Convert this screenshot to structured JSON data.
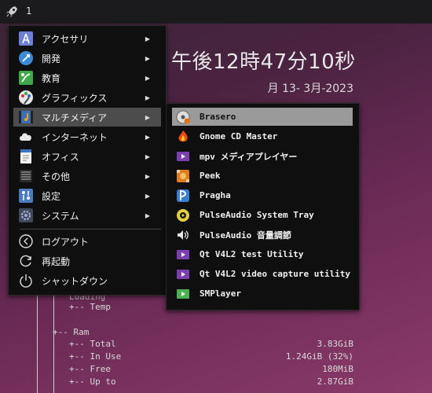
{
  "panel": {
    "workspace": "1",
    "launcher_icon": "rocket-icon"
  },
  "clock": {
    "time": "午後12時47分10秒",
    "date": "月 13- 3月-2023"
  },
  "menu": {
    "items": [
      {
        "label": "アクセサリ",
        "icon": "accessories-icon",
        "has_submenu": true
      },
      {
        "label": "開発",
        "icon": "development-icon",
        "has_submenu": true
      },
      {
        "label": "教育",
        "icon": "education-icon",
        "has_submenu": true
      },
      {
        "label": "グラフィックス",
        "icon": "graphics-icon",
        "has_submenu": true
      },
      {
        "label": "マルチメディア",
        "icon": "multimedia-icon",
        "has_submenu": true,
        "selected": true
      },
      {
        "label": "インターネット",
        "icon": "internet-icon",
        "has_submenu": true
      },
      {
        "label": "オフィス",
        "icon": "office-icon",
        "has_submenu": true
      },
      {
        "label": "その他",
        "icon": "other-icon",
        "has_submenu": true
      },
      {
        "label": "設定",
        "icon": "settings-icon",
        "has_submenu": true
      },
      {
        "label": "システム",
        "icon": "system-icon",
        "has_submenu": true
      }
    ],
    "session": [
      {
        "label": "ログアウト",
        "icon": "logout-icon"
      },
      {
        "label": "再起動",
        "icon": "reboot-icon"
      },
      {
        "label": "シャットダウン",
        "icon": "shutdown-icon"
      }
    ]
  },
  "submenu": {
    "items": [
      {
        "label": "Brasero",
        "icon": "brasero-icon",
        "selected": true
      },
      {
        "label": "Gnome CD Master",
        "icon": "gnome-cd-master-icon"
      },
      {
        "label": "mpv メディアプレイヤー",
        "icon": "mpv-icon"
      },
      {
        "label": "Peek",
        "icon": "peek-icon"
      },
      {
        "label": "Pragha",
        "icon": "pragha-icon"
      },
      {
        "label": "PulseAudio System Tray",
        "icon": "pulseaudio-tray-icon"
      },
      {
        "label": "PulseAudio 音量調節",
        "icon": "volume-icon"
      },
      {
        "label": "Qt V4L2 test Utility",
        "icon": "qv4l2-icon"
      },
      {
        "label": "Qt V4L2 video capture utility",
        "icon": "qvidcap-icon"
      },
      {
        "label": "SMPlayer",
        "icon": "smplayer-icon"
      }
    ]
  },
  "conky": {
    "partial": "Loading",
    "temp": "+-- Temp",
    "ram": "+-- Ram",
    "rows": [
      {
        "label": "+-- Total",
        "value": "3.83GiB"
      },
      {
        "label": "+-- In Use",
        "value": "1.24GiB (32%)"
      },
      {
        "label": "+-- Free",
        "value": "180MiB"
      },
      {
        "label": "+-- Up to",
        "value": "2.87GiB"
      }
    ]
  }
}
